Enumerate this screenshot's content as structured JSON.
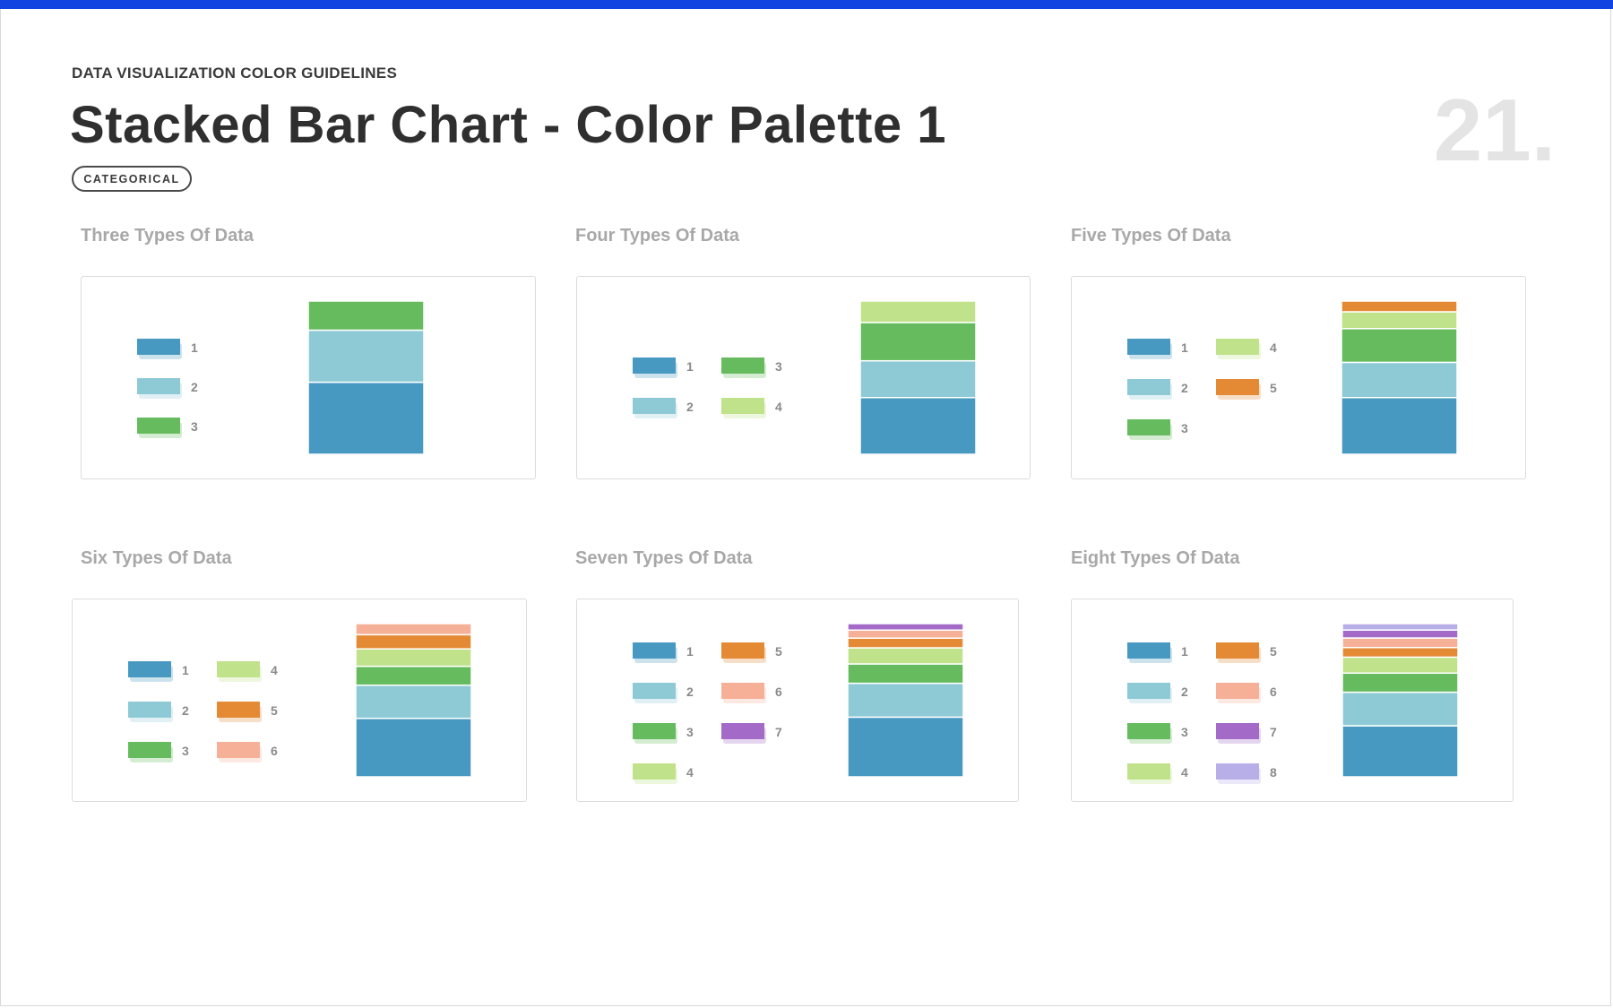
{
  "eyebrow": "DATA VISUALIZATION COLOR GUIDELINES",
  "title": "Stacked Bar Chart - Color Palette 1",
  "tag": "CATEGORICAL",
  "page_number": "21.",
  "colors": {
    "1": "#4799c2",
    "2": "#8ecad6",
    "3": "#66bb5e",
    "4": "#c0e28a",
    "5": "#e48a35",
    "6": "#f6b098",
    "7": "#a36ac8",
    "8": "#b8aee8"
  },
  "accent": "#1144e0",
  "chart_data": [
    {
      "type": "bar",
      "title": "Three Types Of Data",
      "legend": [
        "1",
        "2",
        "3"
      ],
      "series": [
        {
          "name": "1",
          "values": [
            47
          ]
        },
        {
          "name": "2",
          "values": [
            34
          ]
        },
        {
          "name": "3",
          "values": [
            19
          ]
        }
      ]
    },
    {
      "type": "bar",
      "title": "Four Types Of Data",
      "legend": [
        "1",
        "2",
        "3",
        "4"
      ],
      "series": [
        {
          "name": "1",
          "values": [
            37
          ]
        },
        {
          "name": "2",
          "values": [
            24
          ]
        },
        {
          "name": "3",
          "values": [
            25
          ]
        },
        {
          "name": "4",
          "values": [
            14
          ]
        }
      ]
    },
    {
      "type": "bar",
      "title": "Five Types Of Data",
      "legend": [
        "1",
        "2",
        "3",
        "4",
        "5"
      ],
      "series": [
        {
          "name": "1",
          "values": [
            37
          ]
        },
        {
          "name": "2",
          "values": [
            23
          ]
        },
        {
          "name": "3",
          "values": [
            22
          ]
        },
        {
          "name": "4",
          "values": [
            11
          ]
        },
        {
          "name": "5",
          "values": [
            7
          ]
        }
      ]
    },
    {
      "type": "bar",
      "title": "Six Types Of Data",
      "legend": [
        "1",
        "2",
        "3",
        "4",
        "5",
        "6"
      ],
      "series": [
        {
          "name": "1",
          "values": [
            37
          ]
        },
        {
          "name": "2",
          "values": [
            21
          ]
        },
        {
          "name": "3",
          "values": [
            12
          ]
        },
        {
          "name": "4",
          "values": [
            11
          ]
        },
        {
          "name": "5",
          "values": [
            9
          ]
        },
        {
          "name": "6",
          "values": [
            7
          ]
        }
      ]
    },
    {
      "type": "bar",
      "title": "Seven Types Of Data",
      "legend": [
        "1",
        "2",
        "3",
        "4",
        "5",
        "6",
        "7"
      ],
      "series": [
        {
          "name": "1",
          "values": [
            37
          ]
        },
        {
          "name": "2",
          "values": [
            21
          ]
        },
        {
          "name": "3",
          "values": [
            12
          ]
        },
        {
          "name": "4",
          "values": [
            10
          ]
        },
        {
          "name": "5",
          "values": [
            6
          ]
        },
        {
          "name": "6",
          "values": [
            5
          ]
        },
        {
          "name": "7",
          "values": [
            4
          ]
        }
      ]
    },
    {
      "type": "bar",
      "title": "Eight Types Of Data",
      "legend": [
        "1",
        "2",
        "3",
        "4",
        "5",
        "6",
        "7",
        "8"
      ],
      "series": [
        {
          "name": "1",
          "values": [
            32
          ]
        },
        {
          "name": "2",
          "values": [
            21
          ]
        },
        {
          "name": "3",
          "values": [
            12
          ]
        },
        {
          "name": "4",
          "values": [
            10
          ]
        },
        {
          "name": "5",
          "values": [
            6
          ]
        },
        {
          "name": "6",
          "values": [
            6
          ]
        },
        {
          "name": "7",
          "values": [
            5
          ]
        },
        {
          "name": "8",
          "values": [
            4
          ]
        }
      ]
    }
  ]
}
